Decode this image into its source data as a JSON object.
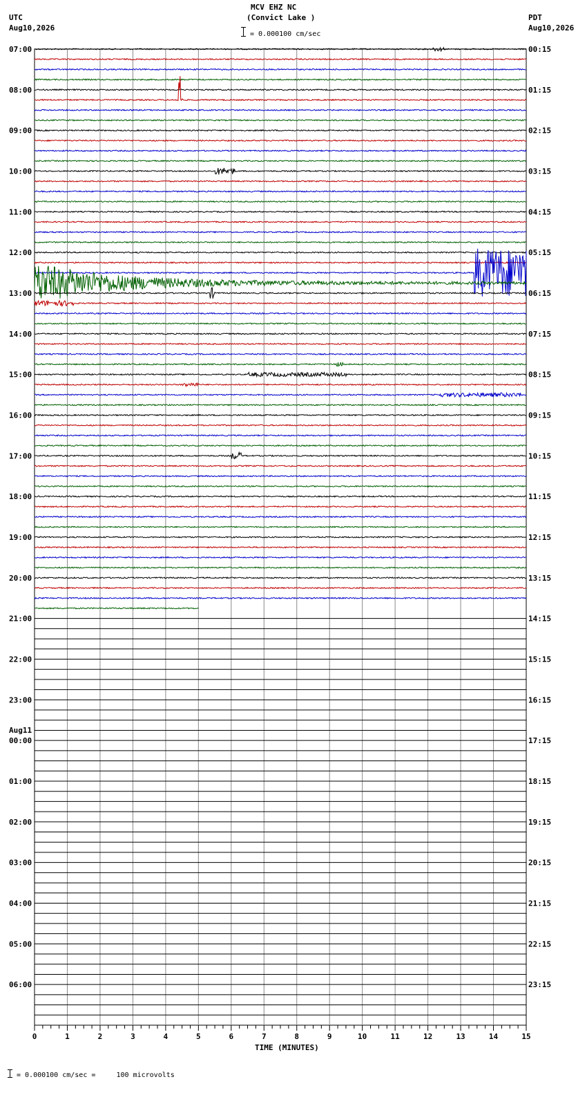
{
  "header": {
    "station": "MCV EHZ NC",
    "location": "(Convict Lake )",
    "scale_label": "= 0.000100 cm/sec",
    "left_tz": "UTC",
    "left_date": "Aug10,2026",
    "right_tz": "PDT",
    "right_date": "Aug10,2026"
  },
  "footer": {
    "scale_note": "= 0.000100 cm/sec =     100 microvolts"
  },
  "chart_data": {
    "type": "line",
    "title": "MCV EHZ NC (Convict Lake )",
    "xlabel": "TIME (MINUTES)",
    "xlim": [
      0,
      15
    ],
    "x_ticks": [
      "0",
      "1",
      "2",
      "3",
      "4",
      "5",
      "6",
      "7",
      "8",
      "9",
      "10",
      "11",
      "12",
      "13",
      "14",
      "15"
    ],
    "rows_per_hour": 4,
    "total_rows": 96,
    "trace_colors": [
      "#000000",
      "#c00000",
      "#0000cc",
      "#006000"
    ],
    "left_hour_labels": [
      "07:00",
      "08:00",
      "09:00",
      "10:00",
      "11:00",
      "12:00",
      "13:00",
      "14:00",
      "15:00",
      "16:00",
      "17:00",
      "18:00",
      "19:00",
      "20:00",
      "21:00",
      "22:00",
      "23:00",
      "00:00",
      "01:00",
      "02:00",
      "03:00",
      "04:00",
      "05:00",
      "06:00"
    ],
    "day_change_label": "Aug11",
    "day_change_index": 17,
    "right_hour_labels": [
      "00:15",
      "01:15",
      "02:15",
      "03:15",
      "04:15",
      "05:15",
      "06:15",
      "07:15",
      "08:15",
      "09:15",
      "10:15",
      "11:15",
      "12:15",
      "13:15",
      "14:15",
      "15:15",
      "16:15",
      "17:15",
      "18:15",
      "19:15",
      "20:15",
      "21:15",
      "22:15",
      "23:15"
    ],
    "recorded_rows": 56,
    "last_row_end_minute": 5.0,
    "events": [
      {
        "row": 0,
        "start_min": 12.15,
        "end_min": 12.5,
        "amp": 3
      },
      {
        "row": 5,
        "start_min": 4.35,
        "end_min": 4.55,
        "amp": 60
      },
      {
        "row": 12,
        "start_min": 5.5,
        "end_min": 6.1,
        "amp": 5
      },
      {
        "row": 22,
        "start_min": 13.4,
        "end_min": 15.0,
        "amp": 35
      },
      {
        "row": 23,
        "start_min": 0.0,
        "end_min": 15.0,
        "amp": 28
      },
      {
        "row": 24,
        "start_min": 5.35,
        "end_min": 5.5,
        "amp": 8
      },
      {
        "row": 25,
        "start_min": 0.0,
        "end_min": 1.2,
        "amp": 4
      },
      {
        "row": 31,
        "start_min": 9.1,
        "end_min": 9.4,
        "amp": 3
      },
      {
        "row": 32,
        "start_min": 6.5,
        "end_min": 9.5,
        "amp": 3
      },
      {
        "row": 33,
        "start_min": 4.5,
        "end_min": 5.0,
        "amp": 3
      },
      {
        "row": 34,
        "start_min": 12.3,
        "end_min": 14.9,
        "amp": 3
      },
      {
        "row": 40,
        "start_min": 6.0,
        "end_min": 6.3,
        "amp": 5
      }
    ]
  }
}
